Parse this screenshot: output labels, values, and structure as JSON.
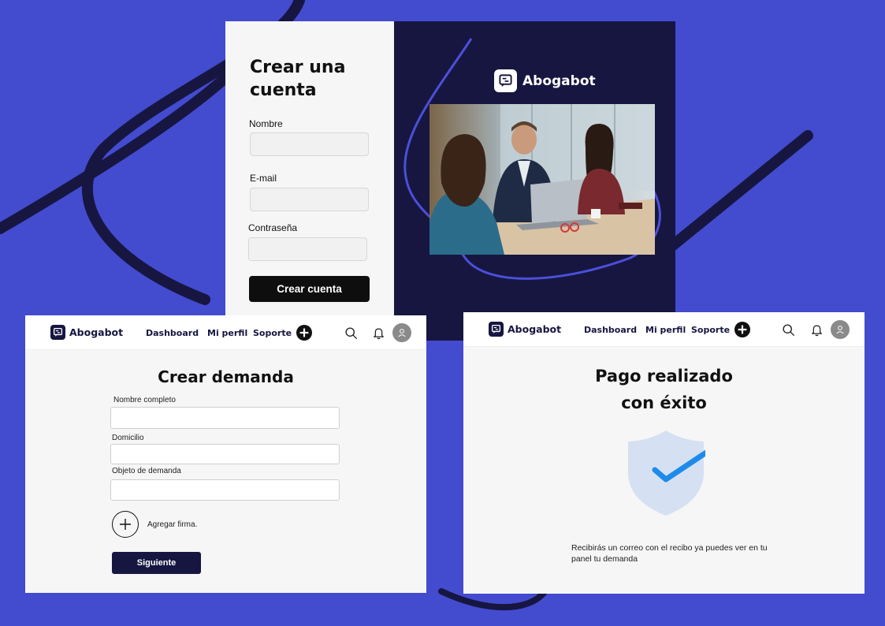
{
  "brand": {
    "name": "Abogabot"
  },
  "signup": {
    "title": "Crear una cuenta",
    "fields": [
      {
        "label": "Nombre",
        "value": ""
      },
      {
        "label": "E-mail",
        "value": ""
      },
      {
        "label": "Contraseña",
        "value": ""
      }
    ],
    "submit_label": "Crear cuenta"
  },
  "nav": {
    "links": [
      "Dashboard",
      "Mi perfil",
      "Soporte"
    ],
    "icons": [
      "plus-icon",
      "search-icon",
      "bell-icon",
      "user-icon"
    ]
  },
  "demand": {
    "title": "Crear demanda",
    "fields": [
      {
        "label": "Nombre completo",
        "value": ""
      },
      {
        "label": "Domicilio",
        "value": ""
      },
      {
        "label": "Objeto de demanda",
        "value": ""
      }
    ],
    "add_signature_label": "Agregar firma.",
    "next_label": "Siguiente"
  },
  "payment": {
    "title_line1": "Pago realizado",
    "title_line2": "con éxito",
    "message": "Recibirás un correo con el recibo ya puedes ver en tu panel tu demanda"
  },
  "colors": {
    "background": "#434bcf",
    "navy": "#161641",
    "check_blue": "#1e8bea",
    "shield": "#d5e1f2"
  }
}
